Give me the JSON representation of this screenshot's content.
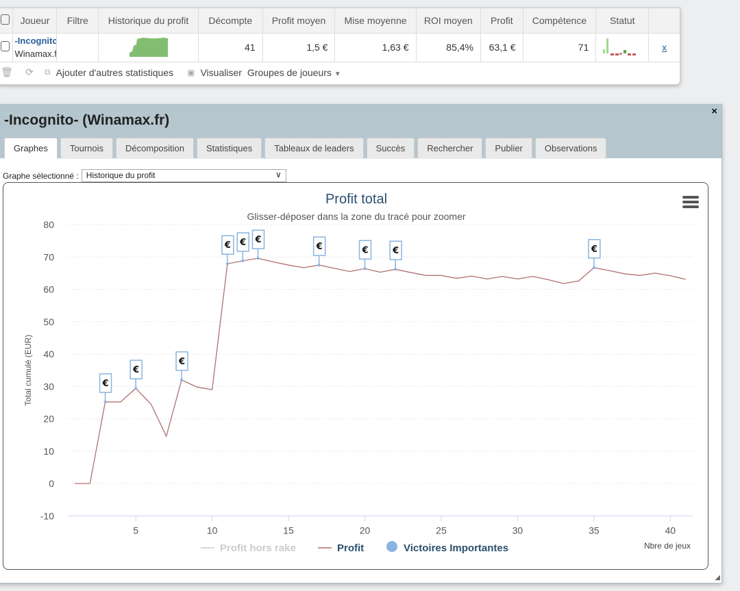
{
  "table": {
    "headers": [
      "Joueur",
      "Filtre",
      "Historique du profit",
      "Décompte",
      "Profit moyen",
      "Mise moyenne",
      "ROI moyen",
      "Profit",
      "Compétence",
      "Statut"
    ],
    "row": {
      "player_name": "-Incognito",
      "player_site": "Winamax.fr",
      "filter": "",
      "count": "41",
      "avg_profit": "1,5 €",
      "avg_stake": "1,63 €",
      "avg_roi": "85,4%",
      "profit": "63,1 €",
      "skill": "71",
      "remove": "x"
    }
  },
  "toolbar": {
    "add_stats": "Ajouter d'autres statistiques",
    "visualize": "Visualiser",
    "player_groups": "Groupes de joueurs"
  },
  "dialog": {
    "title": "-Incognito- (Winamax.fr)",
    "close": "×",
    "tabs": [
      "Graphes",
      "Tournois",
      "Décomposition",
      "Statistiques",
      "Tableaux de leaders",
      "Succès",
      "Rechercher",
      "Publier",
      "Observations"
    ],
    "active_tab": "Graphes",
    "graph_label": "Graphe sélectionné :",
    "graph_value": "Historique du profit"
  },
  "colors": {
    "profit_line": "#b07070",
    "markers": "#8ab4e0",
    "accent": "#2b4f6e"
  },
  "chart_data": {
    "type": "line",
    "title": "Profit total",
    "subtitle": "Glisser-déposer dans la zone du tracé pour zoomer",
    "xlabel": "Nbre de jeux",
    "ylabel": "Total cumulé (EUR)",
    "xlim": [
      1,
      41
    ],
    "ylim": [
      -10,
      80
    ],
    "yticks": [
      -10,
      0,
      10,
      20,
      30,
      40,
      50,
      60,
      70,
      80
    ],
    "xticks": [
      5,
      10,
      15,
      20,
      25,
      30,
      35,
      40
    ],
    "grid": true,
    "legend_position": "bottom",
    "legend": [
      "Profit hors rake",
      "Profit",
      "Victoires Importantes"
    ],
    "series": [
      {
        "name": "Profit",
        "x": [
          1,
          2,
          3,
          4,
          5,
          6,
          7,
          8,
          9,
          10,
          11,
          12,
          13,
          14,
          15,
          16,
          17,
          18,
          19,
          20,
          21,
          22,
          23,
          24,
          25,
          26,
          27,
          28,
          29,
          30,
          31,
          32,
          33,
          34,
          35,
          36,
          37,
          38,
          39,
          40,
          41
        ],
        "values": [
          0,
          0,
          25.2,
          25.2,
          29.4,
          24.5,
          14.6,
          32,
          29.8,
          29,
          67.9,
          68.8,
          69.6,
          68.5,
          67.5,
          66.7,
          67.5,
          66.5,
          65.5,
          66.4,
          65.3,
          66.2,
          65.2,
          64.3,
          64.3,
          63.4,
          64.1,
          63.2,
          64,
          63.2,
          64,
          63,
          61.8,
          62.6,
          66.7,
          65.8,
          64.8,
          64.3,
          65,
          64.2,
          63.1
        ]
      }
    ],
    "big_wins_x": [
      3,
      5,
      8,
      11,
      12,
      13,
      17,
      20,
      22,
      35
    ],
    "big_win_symbol": "€"
  }
}
